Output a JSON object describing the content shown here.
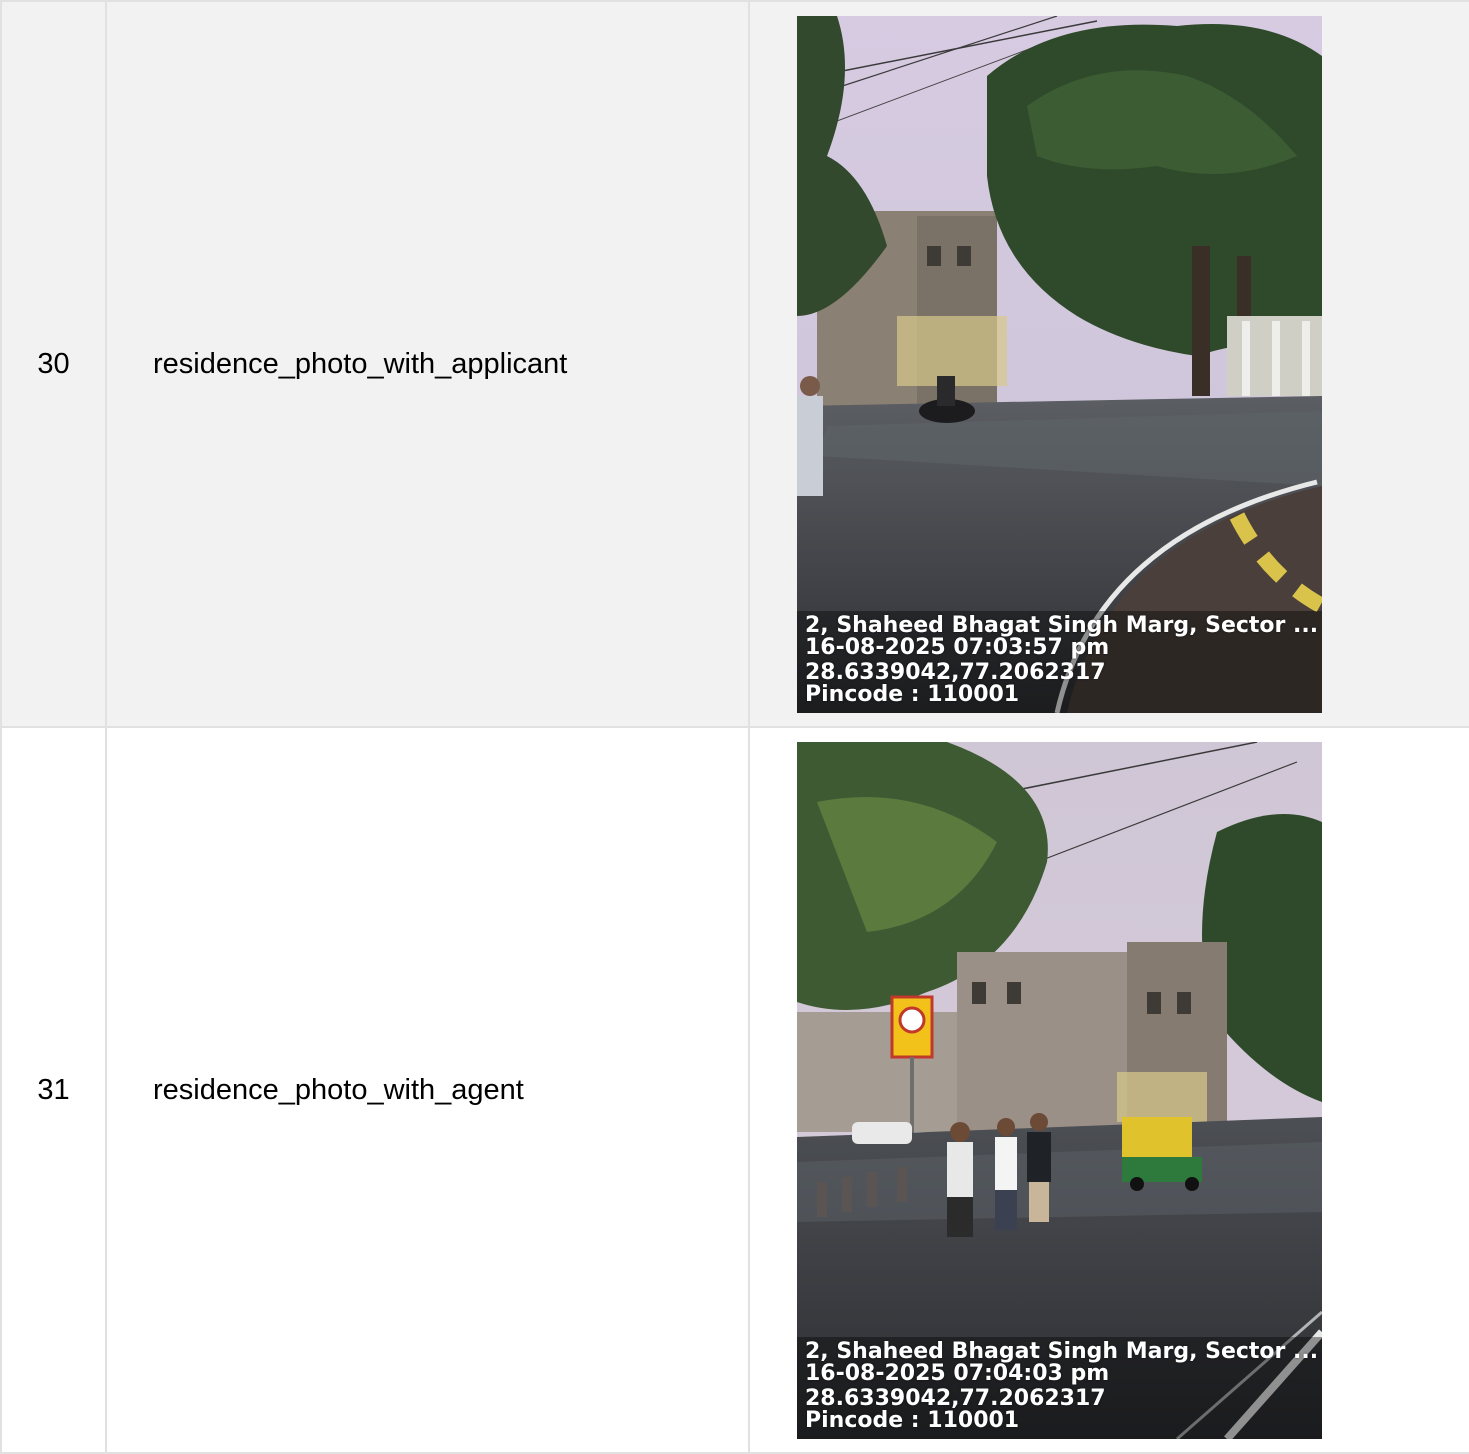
{
  "rows": [
    {
      "index": "30",
      "field": "residence_photo_with_applicant",
      "photo": {
        "address": "2, Shaheed Bhagat Singh Marg, Sector ...",
        "datetime": "16-08-2025 07:03:57 pm",
        "coords": "28.6339042,77.2062317",
        "pincode": "Pincode : 110001"
      }
    },
    {
      "index": "31",
      "field": "residence_photo_with_agent",
      "photo": {
        "address": "2, Shaheed Bhagat Singh Marg, Sector ...",
        "datetime": "16-08-2025 07:04:03 pm",
        "coords": "28.6339042,77.2062317",
        "pincode": "Pincode : 110001"
      }
    }
  ],
  "colors": {
    "grid": "#e1e1e1",
    "row_alt": "#f2f2f2",
    "sky": "#d9cfe4",
    "road": "#3a3a3c",
    "foliage": "#2f4a2a"
  }
}
